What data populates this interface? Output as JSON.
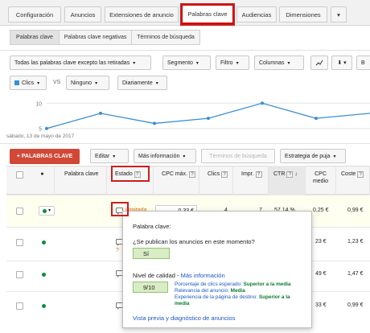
{
  "top_tabs": [
    "Configuración",
    "Anuncios",
    "Extensiones de anuncio",
    "Palabras clave",
    "Audiencias",
    "Dimensiones"
  ],
  "sub_tabs": [
    "Palabras clave",
    "Palabras clave negativas",
    "Términos de búsqueda"
  ],
  "filters": {
    "status_filter": "Todas las palabras clave excepto las retiradas",
    "segment": "Segmento",
    "filter": "Filtro",
    "columns": "Columnas",
    "search_letter": "B"
  },
  "chart_controls": {
    "metric1": "Clics",
    "vs": "VS",
    "metric2": "Ninguno",
    "period": "Diariamente"
  },
  "chart_data": {
    "type": "line",
    "yticks": [
      "10",
      "5"
    ],
    "ylim": [
      4,
      11
    ],
    "values": [
      5,
      8,
      6,
      7,
      10,
      7,
      8
    ],
    "date_label": "sábado, 13 de mayo de 2017",
    "color": "#3a8fd0"
  },
  "actions": {
    "add_keywords": "+ PALABRAS CLAVE",
    "edit": "Editar",
    "more_info": "Más información",
    "search_terms": "Términos de búsqueda",
    "bid_strategy": "Estrategia de puja"
  },
  "table": {
    "headers": {
      "keyword": "Palabra clave",
      "status": "Estado",
      "max_cpc": "CPC máx.",
      "clicks": "Clics",
      "impr": "Impr.",
      "ctr": "CTR",
      "avg_cpc": "CPC medio",
      "cost": "Coste"
    },
    "rows": [
      {
        "status": "Limitada",
        "max_cpc": "0,33 €",
        "clicks": "4",
        "impr": "7",
        "ctr": "57,14 %",
        "avg_cpc": "0,25 €",
        "cost": "0,99 €"
      },
      {
        "avg_cpc": "23 €",
        "cost": "1,23 €"
      },
      {
        "avg_cpc": "49 €",
        "cost": "1,47 €"
      },
      {
        "avg_cpc": "33 €",
        "cost": "0,99 €"
      }
    ]
  },
  "popup": {
    "title": "Palabra clave:",
    "question": "¿Se publican los anuncios en este momento?",
    "answer": "Sí",
    "quality_label": "Nivel de calidad -",
    "more_info_link": "Más información",
    "score": "9/10",
    "detail1_label": "Porcentaje de clics esperado:",
    "detail1_value": "Superior a la media",
    "detail2_label": "Relevancia del anuncio:",
    "detail2_value": "Media",
    "detail3_label": "Experiencia de la página de destino:",
    "detail3_value": "Superior a la",
    "detail3_value2": "media",
    "preview_link": "Vista previa y diagnóstico de anuncios"
  }
}
